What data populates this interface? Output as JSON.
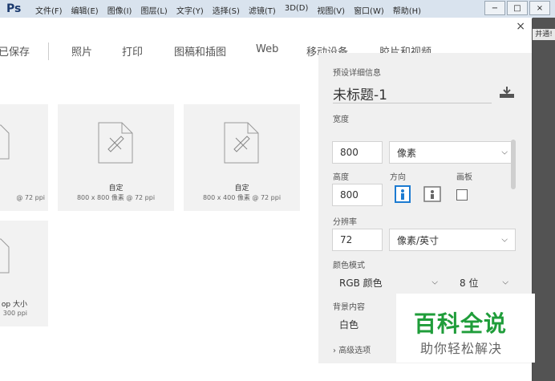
{
  "app": {
    "logo": "Ps",
    "menu": [
      "文件(F)",
      "编辑(E)",
      "图像(I)",
      "图层(L)",
      "文字(Y)",
      "选择(S)",
      "滤镜(T)",
      "3D(D)",
      "视图(V)",
      "窗口(W)",
      "帮助(H)"
    ],
    "window_controls": [
      "−",
      "□",
      "×"
    ],
    "right_label": "并通!"
  },
  "dialog": {
    "close": "×",
    "tabs": [
      "已保存",
      "照片",
      "打印",
      "图稿和插图",
      "Web",
      "移动设备",
      "胶片和视频"
    ],
    "presets": [
      {
        "title": "",
        "sub": "@ 72 ppi"
      },
      {
        "title": "自定",
        "sub": "800 x 800 像素 @ 72 ppi"
      },
      {
        "title": "自定",
        "sub": "800 x 400 像素 @ 72 ppi"
      },
      {
        "title": "op 大小",
        "sub": "300 ppi"
      }
    ]
  },
  "panel": {
    "section_label": "预设详细信息",
    "doc_title": "未标题-1",
    "width_label": "宽度",
    "width_value": "800",
    "width_unit": "像素",
    "height_label": "高度",
    "height_value": "800",
    "orientation_label": "方向",
    "artboard_label": "画板",
    "resolution_label": "分辨率",
    "resolution_value": "72",
    "resolution_unit": "像素/英寸",
    "color_mode_label": "颜色模式",
    "color_mode_value": "RGB 颜色",
    "bit_depth_value": "8 位",
    "background_label": "背景内容",
    "background_value": "白色",
    "advanced_label": "高级选项"
  },
  "watermark": {
    "main": "百科全说",
    "sub": "助你轻松解决"
  },
  "colors": {
    "accent": "#1c7bd1",
    "watermark_green": "#1f9d3a"
  }
}
